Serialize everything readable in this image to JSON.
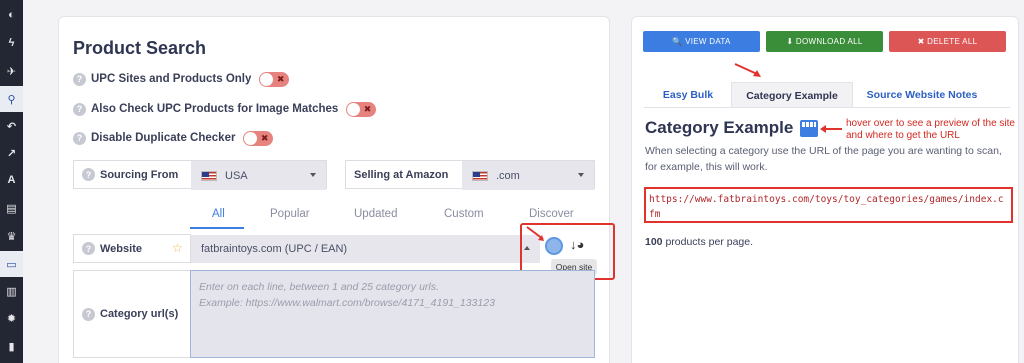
{
  "sidebar": {
    "icons": [
      "dashboard-icon",
      "bolt-icon",
      "plane-icon",
      "search-icon",
      "undo-icon",
      "chart-icon",
      "font-icon",
      "book-icon",
      "trophy-icon",
      "card-icon",
      "barcode-icon",
      "gear-icon",
      "trash-icon"
    ],
    "glyphs": [
      "◐",
      "ϟ",
      "✈",
      "⚲",
      "↶",
      "↗",
      "A",
      "▤",
      "♛",
      "▭",
      "▥",
      "✹",
      "▮"
    ]
  },
  "product_search": {
    "title": "Product Search",
    "options": [
      {
        "label": "UPC Sites and Products Only"
      },
      {
        "label": "Also Check UPC Products for Image Matches"
      },
      {
        "label": "Disable Duplicate Checker"
      }
    ],
    "toggle_x": "✖",
    "sourcing": {
      "label": "Sourcing From",
      "value": "USA"
    },
    "selling": {
      "label": "Selling at Amazon",
      "value": ".com"
    },
    "tabs": [
      "All",
      "Popular",
      "Updated",
      "Custom",
      "Discover"
    ],
    "website": {
      "label": "Website",
      "value": "fatbraintoys.com (UPC / EAN)"
    },
    "category": {
      "label": "Category url(s)",
      "placeholder_line1": "Enter on each line, between 1 and 25 category urls.",
      "placeholder_line2": "Example: https://www.walmart.com/browse/4171_4191_133123"
    },
    "open_site_tooltip": "Open site"
  },
  "right_panel": {
    "buttons": [
      {
        "label": "🔍 VIEW DATA",
        "color": "#3b7de0"
      },
      {
        "label": "⬇ DOWNLOAD ALL",
        "color": "#3a8e3a"
      },
      {
        "label": "✖ DELETE ALL",
        "color": "#dd5656"
      }
    ],
    "tabs": [
      "Easy Bulk",
      "Category Example",
      "Source Website Notes"
    ],
    "heading": "Category Example",
    "annotation": "hover over to see a preview of the site and where to get the URL",
    "description": "When selecting a category use the URL of the page you are wanting to scan, for example, this will work.",
    "example_url": "https://www.fatbraintoys.com/toys/toy_categories/games/index.cfm",
    "per_page_count": "100",
    "per_page_text": " products per page."
  },
  "colors": {
    "accent": "#3b7de0",
    "annotation_red": "#e0332e",
    "toggle_off": "#e7837f"
  }
}
